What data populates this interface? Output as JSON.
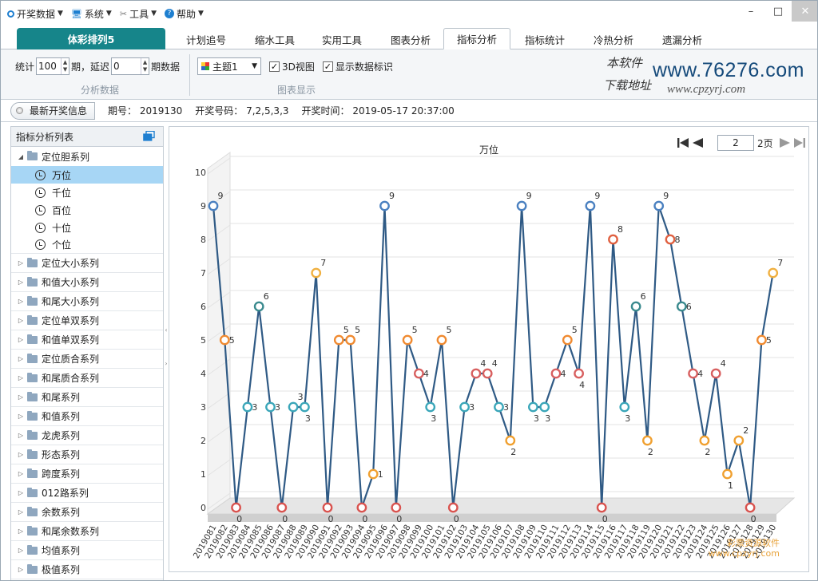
{
  "menu": [
    {
      "label": "开奖数据",
      "icon": "circle-icon"
    },
    {
      "label": "系统",
      "icon": "monitor-icon"
    },
    {
      "label": "工具",
      "icon": "tools-icon"
    },
    {
      "label": "帮助",
      "icon": "help-icon"
    }
  ],
  "window": {
    "minimize": "–",
    "maximize": "□",
    "close": "✕"
  },
  "tabs": {
    "brand": "体彩排列5",
    "items": [
      "计划追号",
      "缩水工具",
      "实用工具",
      "图表分析",
      "指标分析",
      "指标统计",
      "冷热分析",
      "遗漏分析"
    ],
    "active": "指标分析"
  },
  "toolbar": {
    "stat_label": "统计",
    "stat_value": "100",
    "period_delay": "期，延迟",
    "delay_value": "0",
    "period_data": "期数据",
    "group1": "分析数据",
    "theme": "主题1",
    "view3d": "3D视图",
    "show_labels": "显示数据标识",
    "group2": "图表显示"
  },
  "logo": {
    "line1": "本软件",
    "line2": "下载地址",
    "url1": "www.76276.com",
    "url2": "www.cpzyrj.com"
  },
  "info": {
    "latest": "最新开奖信息",
    "period": "期号： 2019130",
    "number": "开奖号码： 7,2,5,3,3",
    "time": "开奖时间： 2019-05-17 20:37:00"
  },
  "sidebar": {
    "title": "指标分析列表",
    "expanded": "定位胆系列",
    "subs": [
      "万位",
      "千位",
      "百位",
      "十位",
      "个位"
    ],
    "selected": "万位",
    "items": [
      "定位大小系列",
      "和值大小系列",
      "和尾大小系列",
      "定位单双系列",
      "和值单双系列",
      "定位质合系列",
      "和尾质合系列",
      "和尾系列",
      "和值系列",
      "龙虎系列",
      "形态系列",
      "跨度系列",
      "012路系列",
      "余数系列",
      "和尾余数系列",
      "均值系列",
      "极值系列"
    ]
  },
  "pager": {
    "current": "2",
    "total": "2页"
  },
  "watermark": {
    "line1": "彩票资源软件",
    "line2": "www.cpzyrj.com"
  },
  "chart_data": {
    "type": "line",
    "title": "万位",
    "ylim": [
      0,
      10
    ],
    "yticks": [
      0,
      1,
      2,
      3,
      4,
      5,
      6,
      7,
      8,
      9,
      10
    ],
    "grid": true,
    "show_3d": true,
    "categories": [
      "2019081",
      "2019082",
      "2019083",
      "2019084",
      "2019085",
      "2019086",
      "2019087",
      "2019088",
      "2019089",
      "2019090",
      "2019091",
      "2019092",
      "2019093",
      "2019094",
      "2019095",
      "2019096",
      "2019097",
      "2019098",
      "2019099",
      "2019100",
      "2019101",
      "2019102",
      "2019103",
      "2019104",
      "2019105",
      "2019106",
      "2019107",
      "2019108",
      "2019109",
      "2019110",
      "2019111",
      "2019112",
      "2019113",
      "2019114",
      "2019115",
      "2019116",
      "2019117",
      "2019118",
      "2019119",
      "2019120",
      "2019121",
      "2019122",
      "2019123",
      "2019124",
      "2019125",
      "2019126",
      "2019127",
      "2019128",
      "2019129",
      "2019130"
    ],
    "values": [
      9,
      5,
      0,
      3,
      6,
      3,
      0,
      3,
      3,
      7,
      0,
      5,
      5,
      0,
      1,
      9,
      0,
      5,
      4,
      3,
      5,
      0,
      3,
      4,
      4,
      3,
      2,
      9,
      3,
      3,
      4,
      5,
      4,
      9,
      0,
      8,
      3,
      6,
      2,
      9,
      8,
      6,
      4,
      2,
      4,
      1,
      2,
      0,
      5,
      7
    ],
    "line_color": "#2f5a85",
    "marker_colors": {
      "0": "#d9534f",
      "1": "#f0a030",
      "2": "#f0a030",
      "3": "#3aa6b9",
      "4": "#d86060",
      "5": "#f08a30",
      "6": "#3a8a8e",
      "7": "#f0b040",
      "8": "#e06040",
      "9": "#4a80c0"
    }
  }
}
